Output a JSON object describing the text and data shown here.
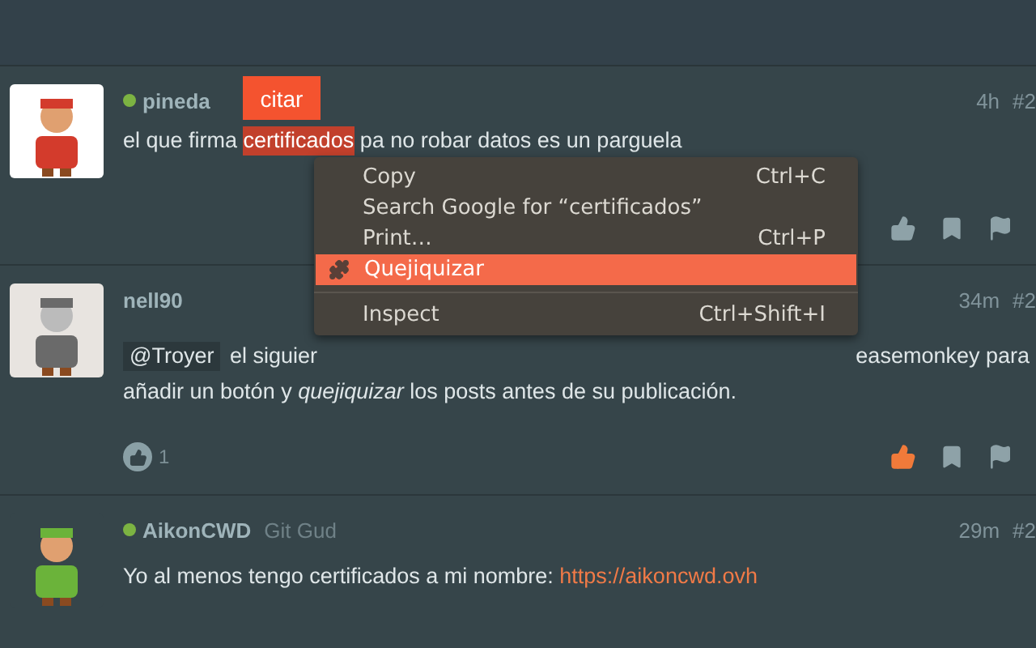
{
  "quote_button": {
    "label": "citar"
  },
  "posts": [
    {
      "author": "pineda",
      "online": true,
      "time": "4h",
      "number": "#2",
      "liked": false,
      "avatar": {
        "kind": "picture"
      },
      "lines": [
        [
          {
            "kind": "text",
            "text": "el que firma "
          },
          {
            "kind": "selected",
            "text": "certificados"
          },
          {
            "kind": "text",
            "text": " pa no robar datos es un parguela"
          }
        ]
      ]
    },
    {
      "author": "nell90",
      "online": false,
      "time": "34m",
      "number": "#2",
      "liked": true,
      "likes": "1",
      "avatar": {
        "kind": "picture"
      },
      "lines": [
        [
          {
            "kind": "mention",
            "text": "@Troyer"
          },
          {
            "kind": "text",
            "text": " el siguier"
          },
          {
            "kind": "tail",
            "text": "easemonkey para"
          }
        ],
        [
          {
            "kind": "text",
            "text": "añadir un botón y "
          },
          {
            "kind": "em",
            "text": "quejiquizar"
          },
          {
            "kind": "text",
            "text": " los posts antes de su publicación."
          }
        ]
      ]
    },
    {
      "author": "AikonCWD",
      "online": true,
      "title": "Git Gud",
      "time": "29m",
      "number": "#2",
      "avatar": {
        "kind": "picture"
      },
      "lines": [
        [
          {
            "kind": "text",
            "text": "Yo al menos tengo certificados a mi nombre: "
          },
          {
            "kind": "link",
            "text": "https://aikoncwd.ovh"
          }
        ]
      ]
    }
  ],
  "context_menu": {
    "items": [
      {
        "kind": "item",
        "label": "Copy",
        "shortcut": "Ctrl+C",
        "selected": false
      },
      {
        "kind": "item",
        "label": "Search Google for “certificados”",
        "selected": false
      },
      {
        "kind": "item",
        "label": "Print…",
        "shortcut": "Ctrl+P",
        "selected": false
      },
      {
        "kind": "extension",
        "label": "Quejiquizar",
        "selected": true
      },
      {
        "kind": "separator"
      },
      {
        "kind": "item",
        "label": "Inspect",
        "shortcut": "Ctrl+Shift+I",
        "selected": false
      }
    ]
  }
}
